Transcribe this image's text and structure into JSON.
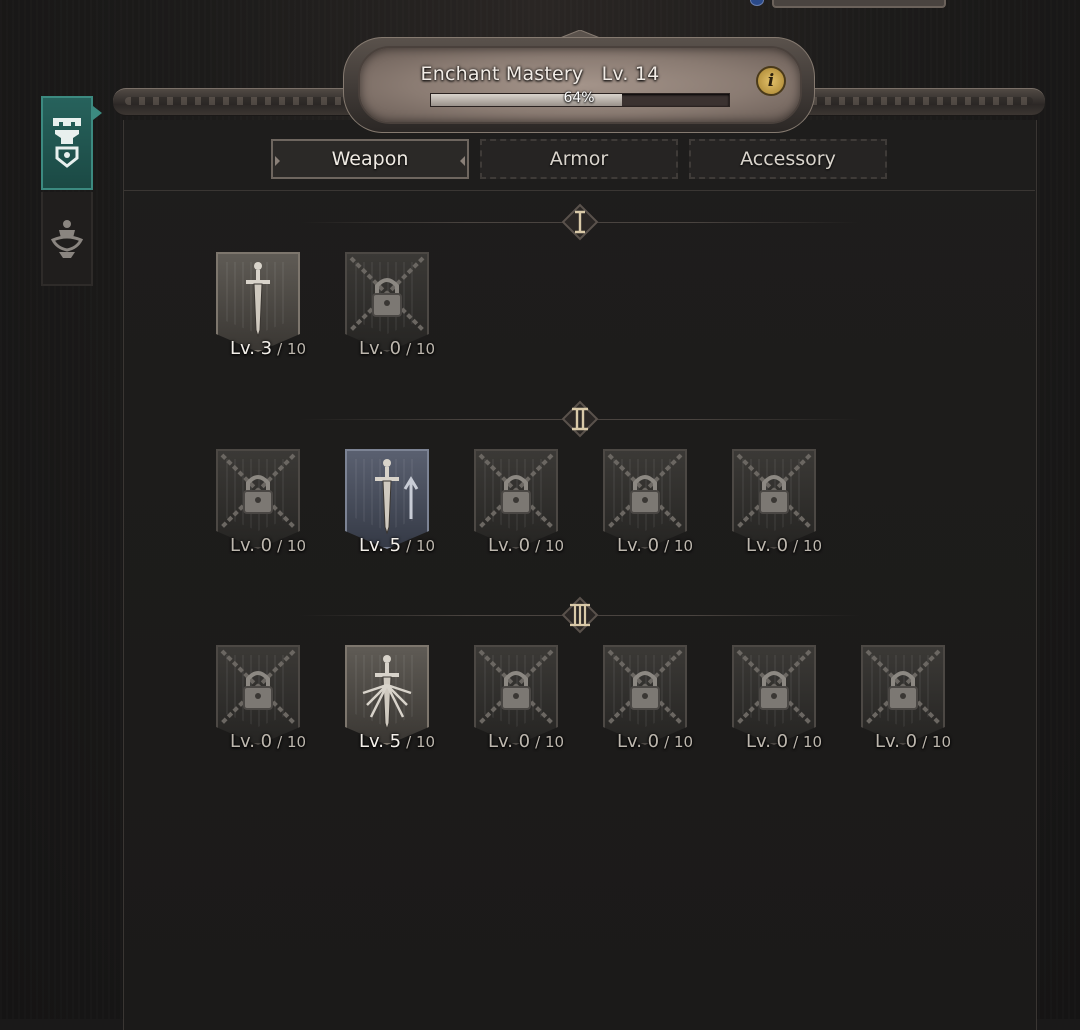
{
  "header": {
    "title": "Enchant Mastery",
    "level_text": "Lv. 14",
    "progress_text": "64%",
    "progress": 0.64,
    "info_icon": "info-icon"
  },
  "side_tabs": [
    {
      "icon": "anvil-emblem-icon",
      "active": true
    },
    {
      "icon": "artifact-emblem-icon",
      "active": false
    }
  ],
  "tabs": [
    {
      "label": "Weapon",
      "active": true
    },
    {
      "label": "Armor",
      "active": false
    },
    {
      "label": "Accessory",
      "active": false
    }
  ],
  "tiers": [
    {
      "label": "I",
      "skills": [
        {
          "cur": "Lv. 3",
          "max": "/ 10",
          "state": "unlocked",
          "icon": "sword-icon"
        },
        {
          "cur": "Lv. 0",
          "max": "/ 10",
          "state": "locked",
          "icon": "lock-icon"
        }
      ]
    },
    {
      "label": "II",
      "skills": [
        {
          "cur": "Lv. 0",
          "max": "/ 10",
          "state": "locked",
          "icon": "lock-icon"
        },
        {
          "cur": "Lv. 5",
          "max": "/ 10",
          "state": "unlocked-blue",
          "icon": "sword-arrow-icon"
        },
        {
          "cur": "Lv. 0",
          "max": "/ 10",
          "state": "locked",
          "icon": "lock-icon"
        },
        {
          "cur": "Lv. 0",
          "max": "/ 10",
          "state": "locked",
          "icon": "lock-icon"
        },
        {
          "cur": "Lv. 0",
          "max": "/ 10",
          "state": "locked",
          "icon": "lock-icon"
        }
      ]
    },
    {
      "label": "III",
      "skills": [
        {
          "cur": "Lv. 0",
          "max": "/ 10",
          "state": "locked",
          "icon": "lock-icon"
        },
        {
          "cur": "Lv. 5",
          "max": "/ 10",
          "state": "unlocked",
          "icon": "sword-burst-icon"
        },
        {
          "cur": "Lv. 0",
          "max": "/ 10",
          "state": "locked",
          "icon": "lock-icon"
        },
        {
          "cur": "Lv. 0",
          "max": "/ 10",
          "state": "locked",
          "icon": "lock-icon"
        },
        {
          "cur": "Lv. 0",
          "max": "/ 10",
          "state": "locked",
          "icon": "lock-icon"
        },
        {
          "cur": "Lv. 0",
          "max": "/ 10",
          "state": "locked",
          "icon": "lock-icon"
        }
      ]
    }
  ],
  "colors": {
    "accent_teal": "#27625c",
    "plaque": "#8a7b72",
    "gold": "#d9c9a8"
  }
}
